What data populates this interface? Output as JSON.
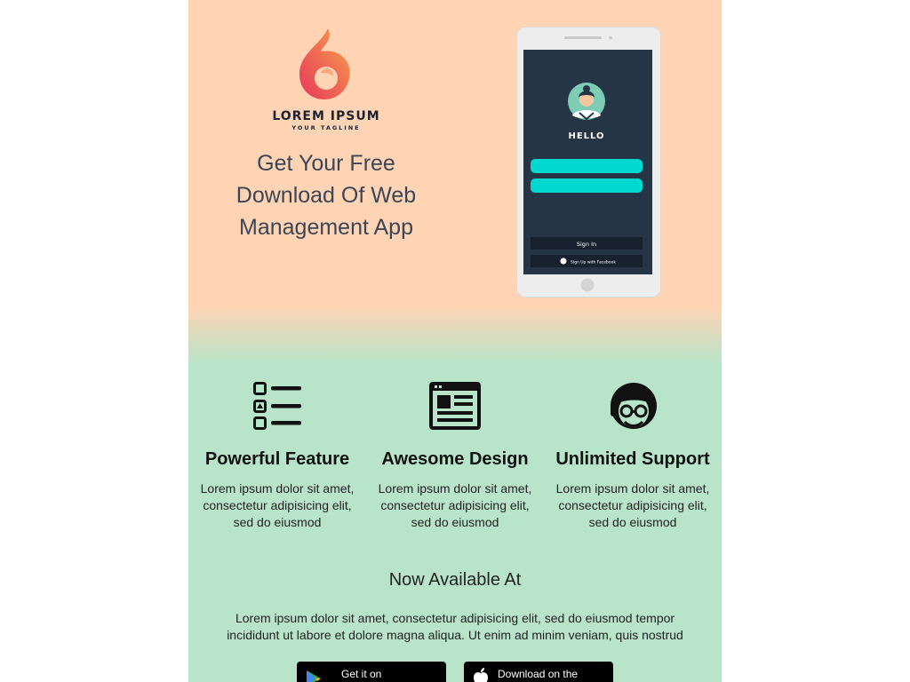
{
  "brand": {
    "name": "LOREM IPSUM",
    "tagline": "YOUR TAGLINE",
    "logo_icon": "flame-drop-icon"
  },
  "hero": {
    "headline": "Get Your Free Download Of Web Management App",
    "phone": {
      "greeting": "HELLO",
      "signin_label": "Sign In",
      "facebook_label": "Sign Up with Facebook"
    }
  },
  "features": [
    {
      "icon": "list-icon",
      "title": "Powerful Feature",
      "description": "Lorem ipsum dolor sit amet, consectetur adipisicing elit, sed do eiusmod"
    },
    {
      "icon": "layout-icon",
      "title": "Awesome Design",
      "description": "Lorem ipsum dolor sit amet, consectetur adipisicing elit, sed do eiusmod"
    },
    {
      "icon": "support-agent-icon",
      "title": "Unlimited Support",
      "description": "Lorem ipsum dolor sit amet, consectetur adipisicing elit, sed do eiusmod"
    }
  ],
  "availability": {
    "title": "Now Available At",
    "description": "Lorem ipsum dolor sit amet, consectetur adipisicing elit, sed do eiusmod tempor incididunt ut labore et dolore magna aliqua. Ut enim ad minim veniam, quis nostrud",
    "google_play_label": "Get it on",
    "app_store_label": "Download on the"
  },
  "colors": {
    "hero_bg": "#fed4b4",
    "features_bg": "#b8e5c9",
    "phone_screen": "#263545",
    "phone_accent": "#00d8d0",
    "logo_gradient_start": "#ef4b5e",
    "logo_gradient_end": "#f7a14a"
  }
}
